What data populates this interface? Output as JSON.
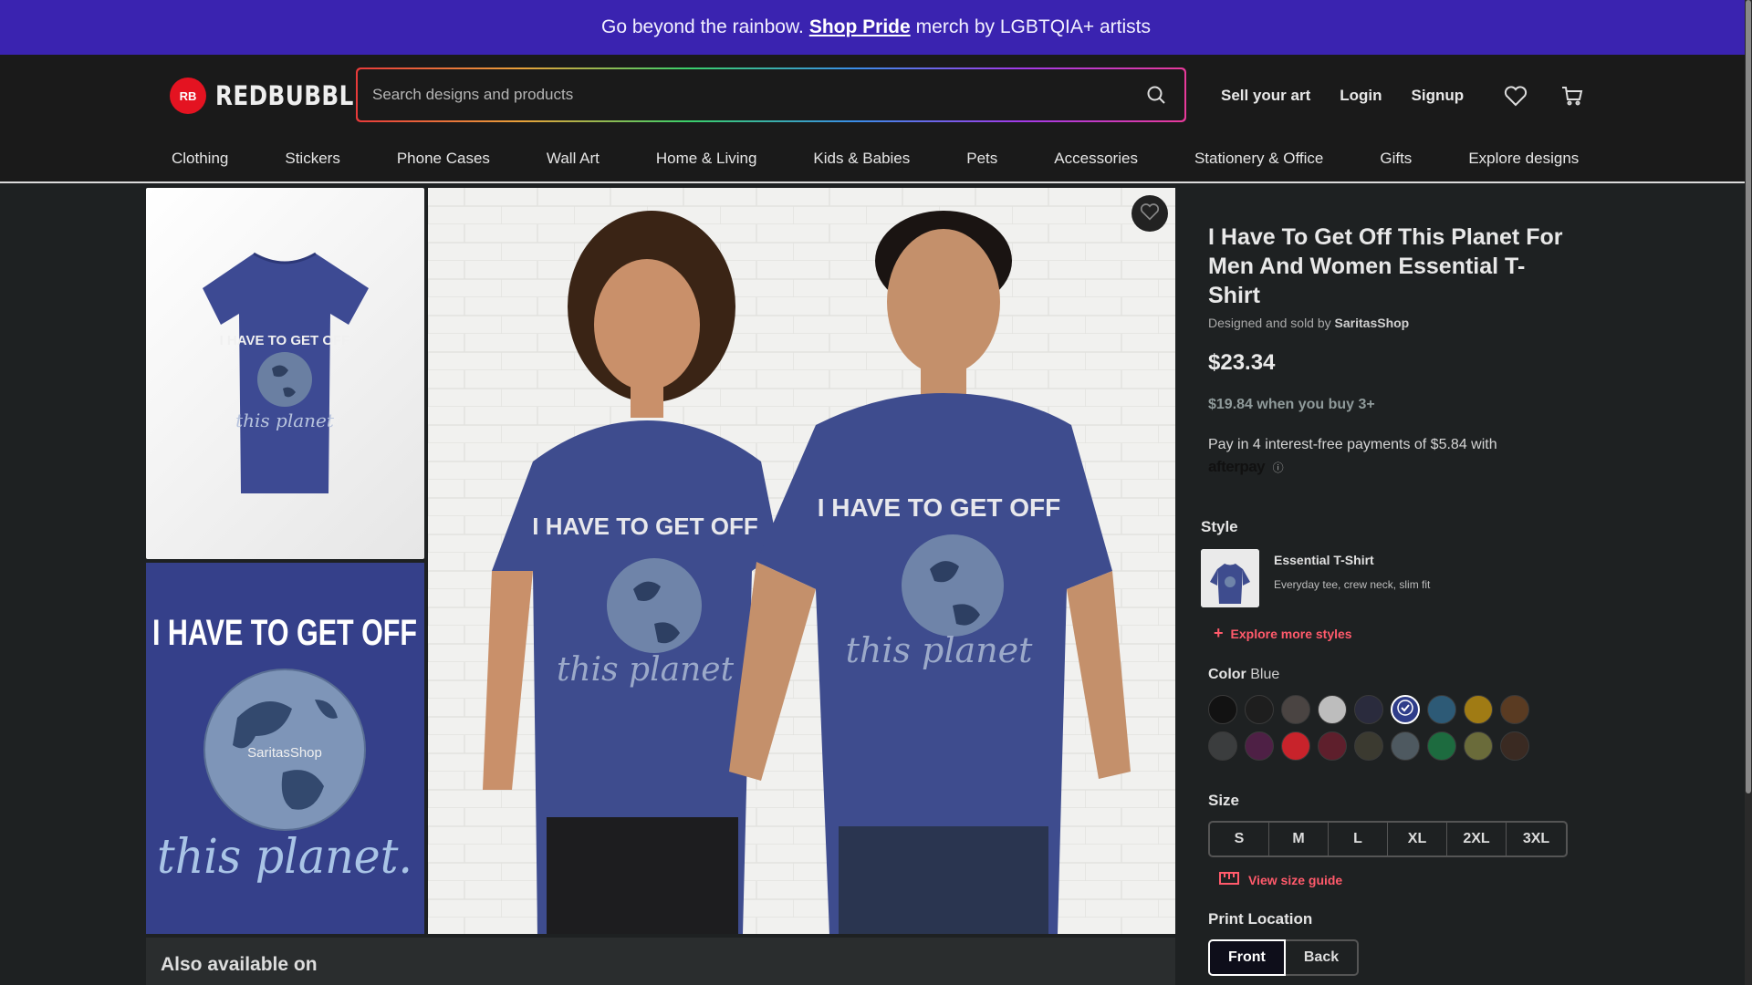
{
  "banner": {
    "prefix": "Go beyond the rainbow.",
    "link": "Shop Pride",
    "suffix": "merch by LGBTQIA+ artists"
  },
  "header": {
    "brand": "REDBUBBLE",
    "logo_mark": "RB",
    "search_placeholder": "Search designs and products",
    "sell_label": "Sell your art",
    "login_label": "Login",
    "signup_label": "Signup"
  },
  "nav": [
    "Clothing",
    "Stickers",
    "Phone Cases",
    "Wall Art",
    "Home & Living",
    "Kids & Babies",
    "Pets",
    "Accessories",
    "Stationery & Office",
    "Gifts",
    "Explore designs"
  ],
  "gallery": {
    "thumb_text_top": "I HAVE TO GET OFF",
    "thumb_text_bottom": "this planet",
    "design_text_top": "I HAVE TO GET OFF",
    "design_text_bottom": "this planet.",
    "watermark": "SaritasShop"
  },
  "product": {
    "title": "I Have To Get Off This Planet For Men And Women Essential T-Shirt",
    "designed_by_prefix": "Designed and sold by",
    "artist": "SaritasShop",
    "price": "$23.34",
    "bulk_price": "$19.84 when you buy 3+",
    "pay_text": "Pay in 4 interest-free payments of $5.84 with",
    "afterpay": "afterpay",
    "style_label": "Style",
    "style_name": "Essential T-Shirt",
    "style_desc": "Everyday tee, crew neck, slim fit",
    "explore_styles": "Explore more styles",
    "color_label": "Color",
    "color_value": "Blue",
    "size_label": "Size",
    "sizes": [
      "S",
      "M",
      "L",
      "XL",
      "2XL",
      "3XL"
    ],
    "size_guide": "View size guide",
    "print_label": "Print Location",
    "print_front": "Front",
    "print_back": "Back"
  },
  "swatches": [
    "#121212",
    "#1e1e1e",
    "#4a4442",
    "#bdbdbd",
    "#2a2b3d",
    "#2f3d8a",
    "#2d5a76",
    "#a07b14",
    "#5a3b22",
    "#3b3d3e",
    "#4e2045",
    "#c8232b",
    "#5e1f2c",
    "#3b3a30",
    "#4e5960",
    "#1d6b3f",
    "#6a6b3a",
    "#3a2a22"
  ],
  "selected_swatch": 5,
  "also_available": "Also available on"
}
